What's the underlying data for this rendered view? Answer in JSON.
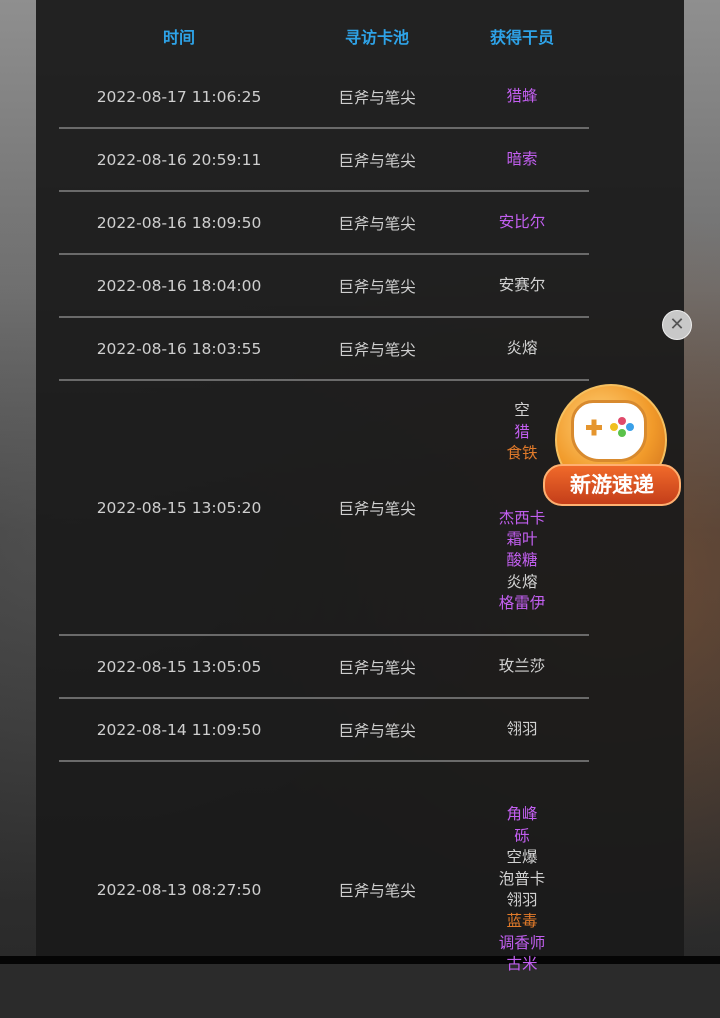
{
  "table": {
    "headers": {
      "time": "时间",
      "pool": "寻访卡池",
      "operator": "获得干员"
    },
    "rows": [
      {
        "time": "2022-08-17 11:06:25",
        "pool": "巨斧与笔尖",
        "operators": [
          {
            "name": "猎蜂",
            "color": "purple"
          }
        ]
      },
      {
        "time": "2022-08-16 20:59:11",
        "pool": "巨斧与笔尖",
        "operators": [
          {
            "name": "暗索",
            "color": "purple"
          }
        ]
      },
      {
        "time": "2022-08-16 18:09:50",
        "pool": "巨斧与笔尖",
        "operators": [
          {
            "name": "安比尔",
            "color": "purple"
          }
        ]
      },
      {
        "time": "2022-08-16 18:04:00",
        "pool": "巨斧与笔尖",
        "operators": [
          {
            "name": "安赛尔",
            "color": "gray"
          }
        ]
      },
      {
        "time": "2022-08-16 18:03:55",
        "pool": "巨斧与笔尖",
        "operators": [
          {
            "name": "炎熔",
            "color": "gray"
          }
        ]
      },
      {
        "time": "2022-08-15 13:05:20",
        "pool": "巨斧与笔尖",
        "operators": [
          {
            "name": "空",
            "color": "gray"
          },
          {
            "name": "猎",
            "color": "purple"
          },
          {
            "name": "食铁",
            "color": "orange"
          },
          {
            "name": "",
            "color": "gray"
          },
          {
            "name": "",
            "color": "gray"
          },
          {
            "name": "杰西卡",
            "color": "purple"
          },
          {
            "name": "霜叶",
            "color": "purple"
          },
          {
            "name": "酸糖",
            "color": "purple"
          },
          {
            "name": "炎熔",
            "color": "gray"
          },
          {
            "name": "格雷伊",
            "color": "purple"
          }
        ]
      },
      {
        "time": "2022-08-15 13:05:05",
        "pool": "巨斧与笔尖",
        "operators": [
          {
            "name": "玫兰莎",
            "color": "gray"
          }
        ]
      },
      {
        "time": "2022-08-14 11:09:50",
        "pool": "巨斧与笔尖",
        "operators": [
          {
            "name": "翎羽",
            "color": "gray"
          }
        ]
      },
      {
        "time": "2022-08-13 08:27:50",
        "pool": "巨斧与笔尖",
        "operators": [
          {
            "name": "角峰",
            "color": "purple"
          },
          {
            "name": "砾",
            "color": "purple"
          },
          {
            "name": "空爆",
            "color": "gray"
          },
          {
            "name": "泡普卡",
            "color": "gray"
          },
          {
            "name": "翎羽",
            "color": "gray"
          },
          {
            "name": "蓝毒",
            "color": "orange"
          },
          {
            "name": "调香师",
            "color": "purple"
          },
          {
            "name": "古米",
            "color": "purple"
          }
        ]
      }
    ]
  },
  "ad": {
    "label": "新游速递",
    "close_symbol": "✕"
  },
  "colors": {
    "header": "#2ea3e8",
    "purple": "#c25ff0",
    "orange": "#e07a2a",
    "gray": "#d2d2d2"
  }
}
